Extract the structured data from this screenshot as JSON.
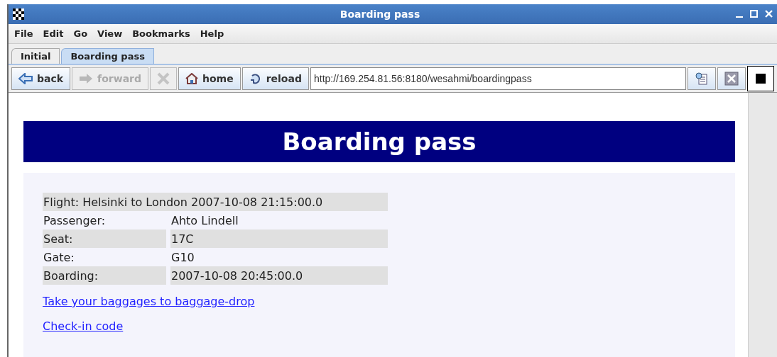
{
  "window": {
    "title": "Boarding pass"
  },
  "menu": [
    "File",
    "Edit",
    "Go",
    "View",
    "Bookmarks",
    "Help"
  ],
  "tabs": [
    {
      "label": "Initial",
      "selected": false
    },
    {
      "label": "Boarding pass",
      "selected": true
    }
  ],
  "toolbar": [
    {
      "kind": "back",
      "label": "back",
      "disabled": false
    },
    {
      "kind": "forward",
      "label": "forward",
      "disabled": true
    },
    {
      "kind": "stop",
      "disabled": true
    },
    {
      "kind": "home",
      "label": "home",
      "disabled": false
    },
    {
      "kind": "reload",
      "label": "reload",
      "disabled": false
    }
  ],
  "address": {
    "value": "http://169.254.81.56:8180/wesahmi/boardingpass"
  },
  "page": {
    "heading": "Boarding pass",
    "flight": "Flight: Helsinki to London 2007-10-08 21:15:00.0",
    "rows": [
      {
        "label": "Passenger:",
        "value": "Ahto Lindell"
      },
      {
        "label": "Seat:",
        "value": "17C"
      },
      {
        "label": "Gate:",
        "value": "G10"
      },
      {
        "label": "Boarding:",
        "value": "2007-10-08 20:45:00.0"
      }
    ],
    "links": [
      "Take your baggages to baggage-drop ",
      "Check-in code "
    ]
  }
}
